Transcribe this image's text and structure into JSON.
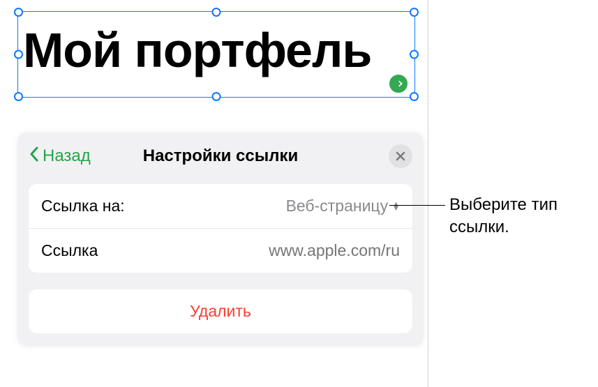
{
  "textbox": {
    "content": "Мой портфель"
  },
  "popover": {
    "back_label": "Назад",
    "title": "Настройки ссылки",
    "rows": {
      "link_to": {
        "label": "Ссылка на:",
        "value": "Веб-страницу"
      },
      "link": {
        "label": "Ссылка",
        "placeholder": "www.apple.com/ru"
      }
    },
    "delete_label": "Удалить"
  },
  "callout": {
    "text": "Выберите тип ссылки."
  }
}
